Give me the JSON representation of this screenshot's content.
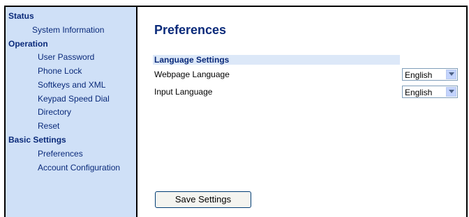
{
  "sidebar": {
    "sections": [
      {
        "label": "Status",
        "items": [
          {
            "label": "System Information"
          }
        ]
      },
      {
        "label": "Operation",
        "items": [
          {
            "label": "User Password"
          },
          {
            "label": "Phone Lock"
          },
          {
            "label": "Softkeys and XML"
          },
          {
            "label": "Keypad Speed Dial"
          },
          {
            "label": "Directory"
          },
          {
            "label": "Reset"
          }
        ]
      },
      {
        "label": "Basic Settings",
        "items": [
          {
            "label": "Preferences"
          },
          {
            "label": "Account Configuration"
          }
        ]
      }
    ]
  },
  "main": {
    "title": "Preferences",
    "section_title": "Language Settings",
    "fields": [
      {
        "label": "Webpage Language",
        "value": "English"
      },
      {
        "label": "Input Language",
        "value": "English"
      }
    ],
    "save_label": "Save Settings"
  }
}
